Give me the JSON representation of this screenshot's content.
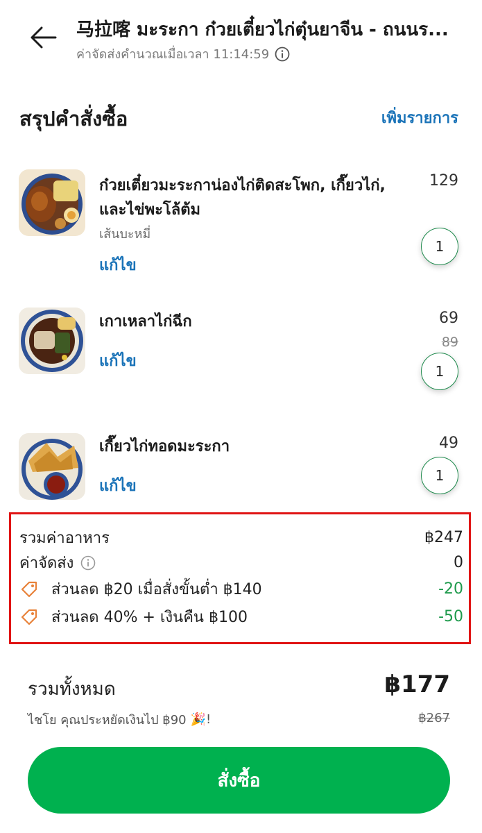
{
  "header": {
    "title": "马拉喀 มะระกา ก๋วยเตี๋ยวไก่ตุ๋นยาจีน - ถนนร...",
    "subtitle": "ค่าจัดส่งคำนวณเมื่อเวลา 11:14:59"
  },
  "summary_section": {
    "title": "สรุปคำสั่งซื้อ",
    "add_items": "เพิ่มรายการ"
  },
  "items": [
    {
      "name": "ก๋วยเตี๋ยวมะระกาน่องไก่ติดสะโพก, เกี๊ยวไก่, และไข่พะโล้ต้ม",
      "option": "เส้นบะหมี่",
      "edit": "แก้ไข",
      "price": "129",
      "old_price": "",
      "qty": "1"
    },
    {
      "name": "เกาเหลาไก่ฉีก",
      "option": "",
      "edit": "แก้ไข",
      "price": "69",
      "old_price": "89",
      "qty": "1"
    },
    {
      "name": "เกี๊ยวไก่ทอดมะระกา",
      "option": "",
      "edit": "แก้ไข",
      "price": "49",
      "old_price": "",
      "qty": "1"
    }
  ],
  "breakdown": {
    "food_label": "รวมค่าอาหาร",
    "food_value": "฿247",
    "delivery_label": "ค่าจัดส่ง",
    "delivery_value": "0",
    "discounts": [
      {
        "label": "ส่วนลด ฿20 เมื่อสั่งขั้นต่ำ ฿140",
        "value": "-20"
      },
      {
        "label": "ส่วนลด 40% + เงินคืน ฿100",
        "value": "-50"
      }
    ]
  },
  "total": {
    "label": "รวมทั้งหมด",
    "value": "฿177",
    "saving_text": "ไชโย คุณประหยัดเงินไป ฿90",
    "saving_emoji": "🎉!",
    "old_total": "฿267"
  },
  "order_button": "สั่งซื้อ",
  "colors": {
    "accent_blue": "#1a73b8",
    "brand_green": "#00b14f",
    "discount_green": "#1e9a4c",
    "tag_orange": "#e8823a",
    "highlight_red": "#e01414"
  }
}
